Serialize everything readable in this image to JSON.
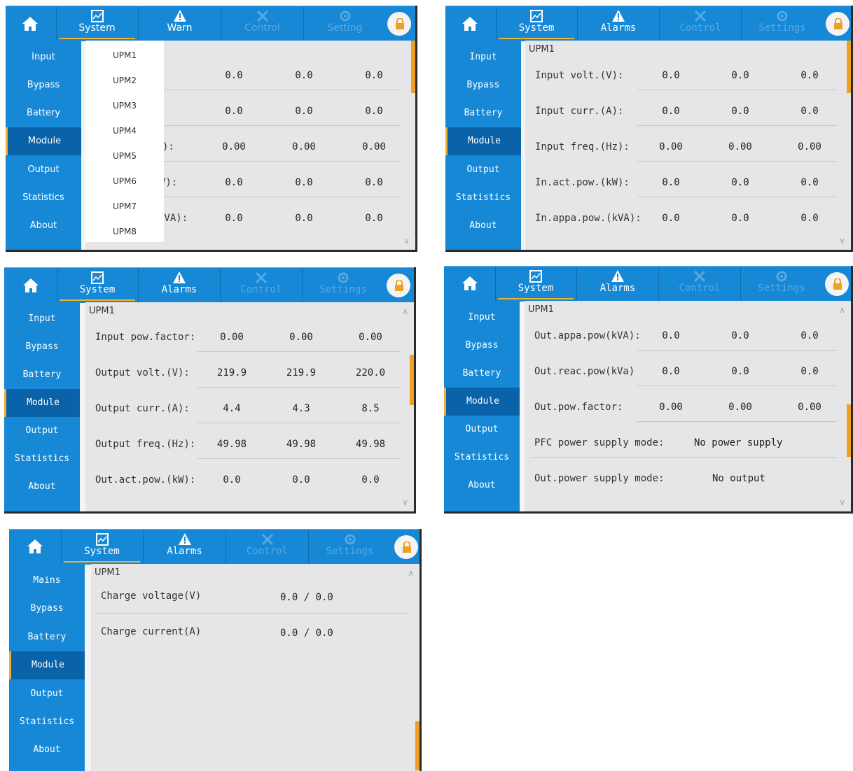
{
  "nav": {
    "system": "System",
    "warn": "Warn",
    "alarms": "Alarms",
    "control": "Control",
    "setting": "Setting",
    "settings": "Settings"
  },
  "sidebar": {
    "input": "Input",
    "mains": "Mains",
    "bypass": "Bypass",
    "battery": "Battery",
    "module": "Module",
    "output": "Output",
    "statistics": "Statistics",
    "about": "About"
  },
  "upm_label": "UPM1",
  "colors": {
    "accent": "#1688d6",
    "selected": "#0a62a8",
    "highlight": "#f0b030"
  },
  "panel1": {
    "dropdown": [
      "UPM1",
      "UPM2",
      "UPM3",
      "UPM4",
      "UPM5",
      "UPM6",
      "UPM7",
      "UPM8"
    ],
    "rows": [
      {
        "k": "",
        "v": [
          "0.0",
          "0.0",
          "0.0"
        ]
      },
      {
        "k": "",
        "v": [
          "0.0",
          "0.0",
          "0.0"
        ]
      },
      {
        "k": "):",
        "v": [
          "0.00",
          "0.00",
          "0.00"
        ]
      },
      {
        "k": "V):",
        "v": [
          "0.0",
          "0.0",
          "0.0"
        ]
      },
      {
        "k": "kVA):",
        "v": [
          "0.0",
          "0.0",
          "0.0"
        ]
      }
    ]
  },
  "panel2": {
    "rows": [
      {
        "k": "Input volt.(V):",
        "v": [
          "0.0",
          "0.0",
          "0.0"
        ]
      },
      {
        "k": "Input curr.(A):",
        "v": [
          "0.0",
          "0.0",
          "0.0"
        ]
      },
      {
        "k": "Input freq.(Hz):",
        "v": [
          "0.00",
          "0.00",
          "0.00"
        ]
      },
      {
        "k": "In.act.pow.(kW):",
        "v": [
          "0.0",
          "0.0",
          "0.0"
        ]
      },
      {
        "k": "In.appa.pow.(kVA):",
        "v": [
          "0.0",
          "0.0",
          "0.0"
        ]
      }
    ]
  },
  "panel3": {
    "rows": [
      {
        "k": "Input pow.factor:",
        "v": [
          "0.00",
          "0.00",
          "0.00"
        ]
      },
      {
        "k": "Output volt.(V):",
        "v": [
          "219.9",
          "219.9",
          "220.0"
        ]
      },
      {
        "k": "Output curr.(A):",
        "v": [
          "4.4",
          "4.3",
          "8.5"
        ]
      },
      {
        "k": "Output freq.(Hz):",
        "v": [
          "49.98",
          "49.98",
          "49.98"
        ]
      },
      {
        "k": "Out.act.pow.(kW):",
        "v": [
          "0.0",
          "0.0",
          "0.0"
        ]
      }
    ]
  },
  "panel4": {
    "rows": [
      {
        "k": "Out.appa.pow(kVA):",
        "v": [
          "0.0",
          "0.0",
          "0.0"
        ]
      },
      {
        "k": "Out.reac.pow(kVa)",
        "v": [
          "0.0",
          "0.0",
          "0.0"
        ]
      },
      {
        "k": "Out.pow.factor:",
        "v": [
          "0.00",
          "0.00",
          "0.00"
        ]
      }
    ],
    "pfc_label": "PFC power supply mode:",
    "pfc_value": "No power supply",
    "out_label": "Out.power supply mode:",
    "out_value": "No output"
  },
  "panel5": {
    "charge_voltage_label": "Charge voltage(V)",
    "charge_voltage_value": "0.0 / 0.0",
    "charge_current_label": "Charge current(A)",
    "charge_current_value": "0.0 / 0.0"
  }
}
